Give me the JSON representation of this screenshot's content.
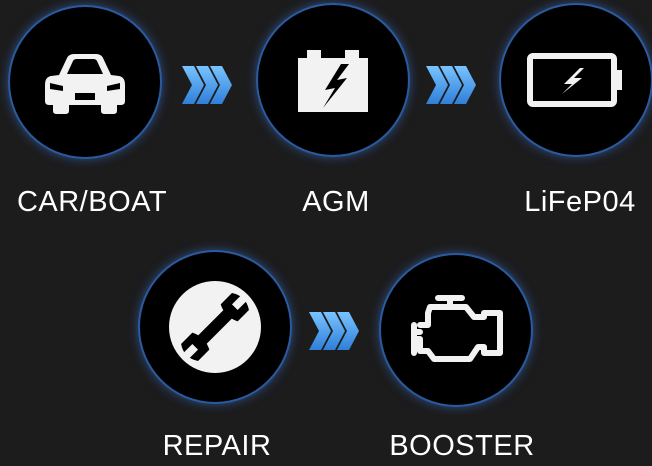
{
  "modes": [
    {
      "id": "car_boat",
      "label": "CAR/BOAT",
      "icon": "car-icon"
    },
    {
      "id": "agm",
      "label": "AGM",
      "icon": "agm-battery-icon"
    },
    {
      "id": "lifepo4",
      "label": "LiFeP04",
      "icon": "lithium-battery-icon"
    },
    {
      "id": "repair",
      "label": "REPAIR",
      "icon": "wrench-icon"
    },
    {
      "id": "booster",
      "label": "BOOSTER",
      "icon": "engine-icon"
    }
  ],
  "colors": {
    "background": "#1c1c1d",
    "ring": "#2a5a9f",
    "chevron": "#4a9ee8",
    "icon": "#ffffff"
  }
}
